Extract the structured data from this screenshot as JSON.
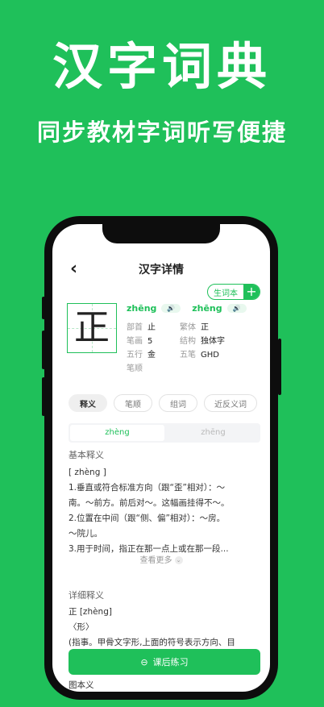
{
  "hero": {
    "title": "汉字词典",
    "subtitle": "同步教材字词听写便捷"
  },
  "nav": {
    "back_icon": "‹",
    "title": "汉字详情"
  },
  "vocab_button": {
    "label": "生词本",
    "plus": "+"
  },
  "character": "正",
  "pinyin": [
    {
      "text": "zhēng",
      "speaker": "🔊"
    },
    {
      "text": "zhēng",
      "speaker": "🔊"
    }
  ],
  "attributes": [
    {
      "key": "部首",
      "value": "止"
    },
    {
      "key": "繁体",
      "value": "正"
    },
    {
      "key": "笔画",
      "value": "5"
    },
    {
      "key": "结构",
      "value": "独体字"
    },
    {
      "key": "五行",
      "value": "金"
    },
    {
      "key": "五笔",
      "value": "GHD"
    },
    {
      "key": "笔顺",
      "value": ""
    }
  ],
  "tabs": [
    "释义",
    "笔顺",
    "组词",
    "近反义词"
  ],
  "segments": [
    "zhèng",
    "zhēng"
  ],
  "basic": {
    "heading": "基本释义",
    "lines": [
      "[ zhèng ]",
      "1.垂直或符合标准方向（跟“歪”相对）：～",
      "南。～前方。前后对～。这幅画挂得不～。",
      "2.位置在中间（跟“侧、偏”相对）：～房。",
      "～院儿。",
      "3.用于时间，指正在那一点上或在那一段..."
    ],
    "more": "查看更多",
    "more_icon": "⌄"
  },
  "detail": {
    "heading": "详细释义",
    "lines": [
      "正 [zhèng]",
      "〈形〉",
      "(指事。甲骨文字形,上面的符号表示方向、目"
    ],
    "hidden_lines": [
      "图本义"
    ]
  },
  "practice_button": {
    "label": "课后练习",
    "icon": "⊖"
  },
  "colors": {
    "brand": "#1fc05a"
  }
}
